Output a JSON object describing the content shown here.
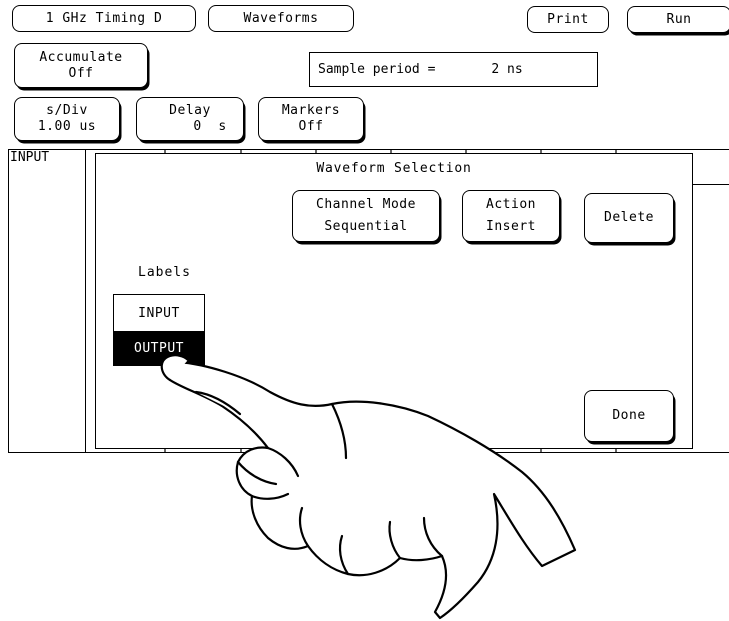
{
  "toolbar": {
    "module": "1 GHz Timing D",
    "menu": "Waveforms",
    "print": "Print",
    "run": "Run"
  },
  "accumulate": {
    "title": "Accumulate",
    "value": "Off"
  },
  "sample_period": {
    "label": "Sample period =",
    "value": "2 ns"
  },
  "sdiv": {
    "title": "s/Div",
    "value": "1.00 us"
  },
  "delay": {
    "title": "Delay",
    "value": "0  s"
  },
  "markers": {
    "title": "Markers",
    "value": "Off"
  },
  "waveform_area": {
    "row_label": "INPUT"
  },
  "dialog": {
    "title": "Waveform Selection",
    "channel_mode": {
      "title": "Channel Mode",
      "value": "Sequential"
    },
    "action": {
      "title": "Action",
      "value": "Insert"
    },
    "delete": "Delete",
    "labels_heading": "Labels",
    "labels": [
      "INPUT",
      "OUTPUT"
    ],
    "selected_label": "OUTPUT",
    "done": "Done"
  }
}
